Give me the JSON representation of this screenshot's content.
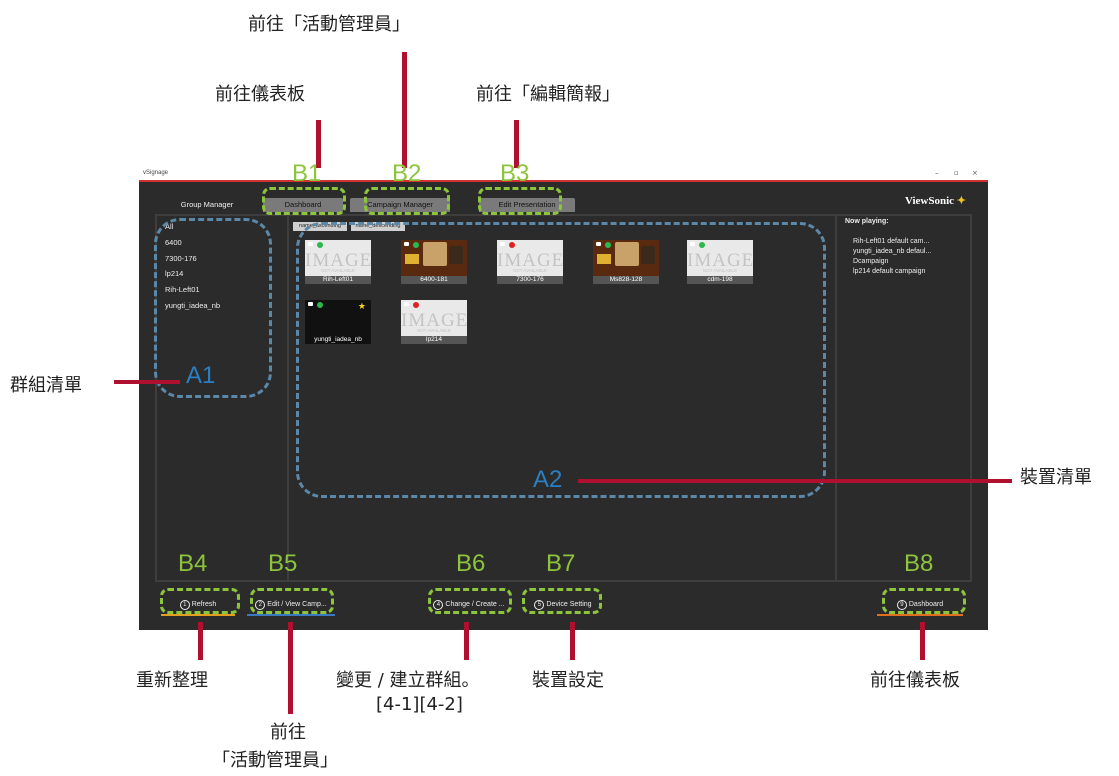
{
  "annotations": {
    "top_campaign": "前往「活動管理員」",
    "dashboard": "前往儀表板",
    "edit_presentation": "前往「編輯簡報」",
    "group_list": "群組清單",
    "device_list": "裝置清單",
    "refresh": "重新整理",
    "bottom_campaign_line1": "前往",
    "bottom_campaign_line2": "「活動管理員」",
    "change_group": "變更 / 建立群組。",
    "device_setting": "裝置設定",
    "change_group_ref": "[4-1][4-2]",
    "dashboard_right": "前往儀表板"
  },
  "tags": {
    "b1": "B1",
    "b2": "B2",
    "b3": "B3",
    "b4": "B4",
    "b5": "B5",
    "b6": "B6",
    "b7": "B7",
    "b8": "B8",
    "a1": "A1",
    "a2": "A2"
  },
  "app": {
    "title": "vSignage",
    "brand": "ViewSonic",
    "tabs": [
      "Group Manager",
      "Dashboard",
      "Campaign Manager",
      "Edit Presentation"
    ],
    "groups": [
      "All",
      "6400",
      "7300-176",
      "lp214",
      "Rih-Left01",
      "yungti_iadea_nb"
    ],
    "sort": [
      "name_ascending",
      "name_descending"
    ],
    "image_placeholder": "IMAGE",
    "image_placeholder_sub": "NOT AVAILABLE",
    "devices": [
      {
        "name": "Rih-Left01",
        "status": "green",
        "thumb": "placeholder"
      },
      {
        "name": "6400-181",
        "status": "green",
        "thumb": "menu"
      },
      {
        "name": "7300-176",
        "status": "red",
        "thumb": "placeholder"
      },
      {
        "name": "Ms828-128",
        "status": "green",
        "thumb": "menu"
      },
      {
        "name": "cdm-198",
        "status": "green",
        "thumb": "placeholder"
      },
      {
        "name": "yungti_iadea_nb",
        "status": "green",
        "thumb": "black",
        "selected": true
      },
      {
        "name": "lp214",
        "status": "red",
        "thumb": "placeholder"
      }
    ],
    "now_playing": {
      "heading": "Now playing:",
      "items": [
        "Rih-Left01 default cam...",
        "yungti_iadea_nb defaul...",
        "Dcampaign",
        "lp214 default campaign"
      ]
    },
    "bottom_buttons": {
      "refresh": {
        "num": "1",
        "label": "Refresh"
      },
      "edit_campaign": {
        "num": "2",
        "label": "Edit / View Camp..."
      },
      "change_create": {
        "num": "4",
        "label": "Change / Create ..."
      },
      "device_setting": {
        "num": "5",
        "label": "Device Setting"
      },
      "dashboard": {
        "num": "9",
        "label": "Dashboard"
      }
    }
  },
  "colors": {
    "accent_red": "#b01030",
    "tag_green": "#8cc43c",
    "tag_blue": "#2c7ec3",
    "status_green": "#2db84d",
    "status_red": "#e02020"
  }
}
